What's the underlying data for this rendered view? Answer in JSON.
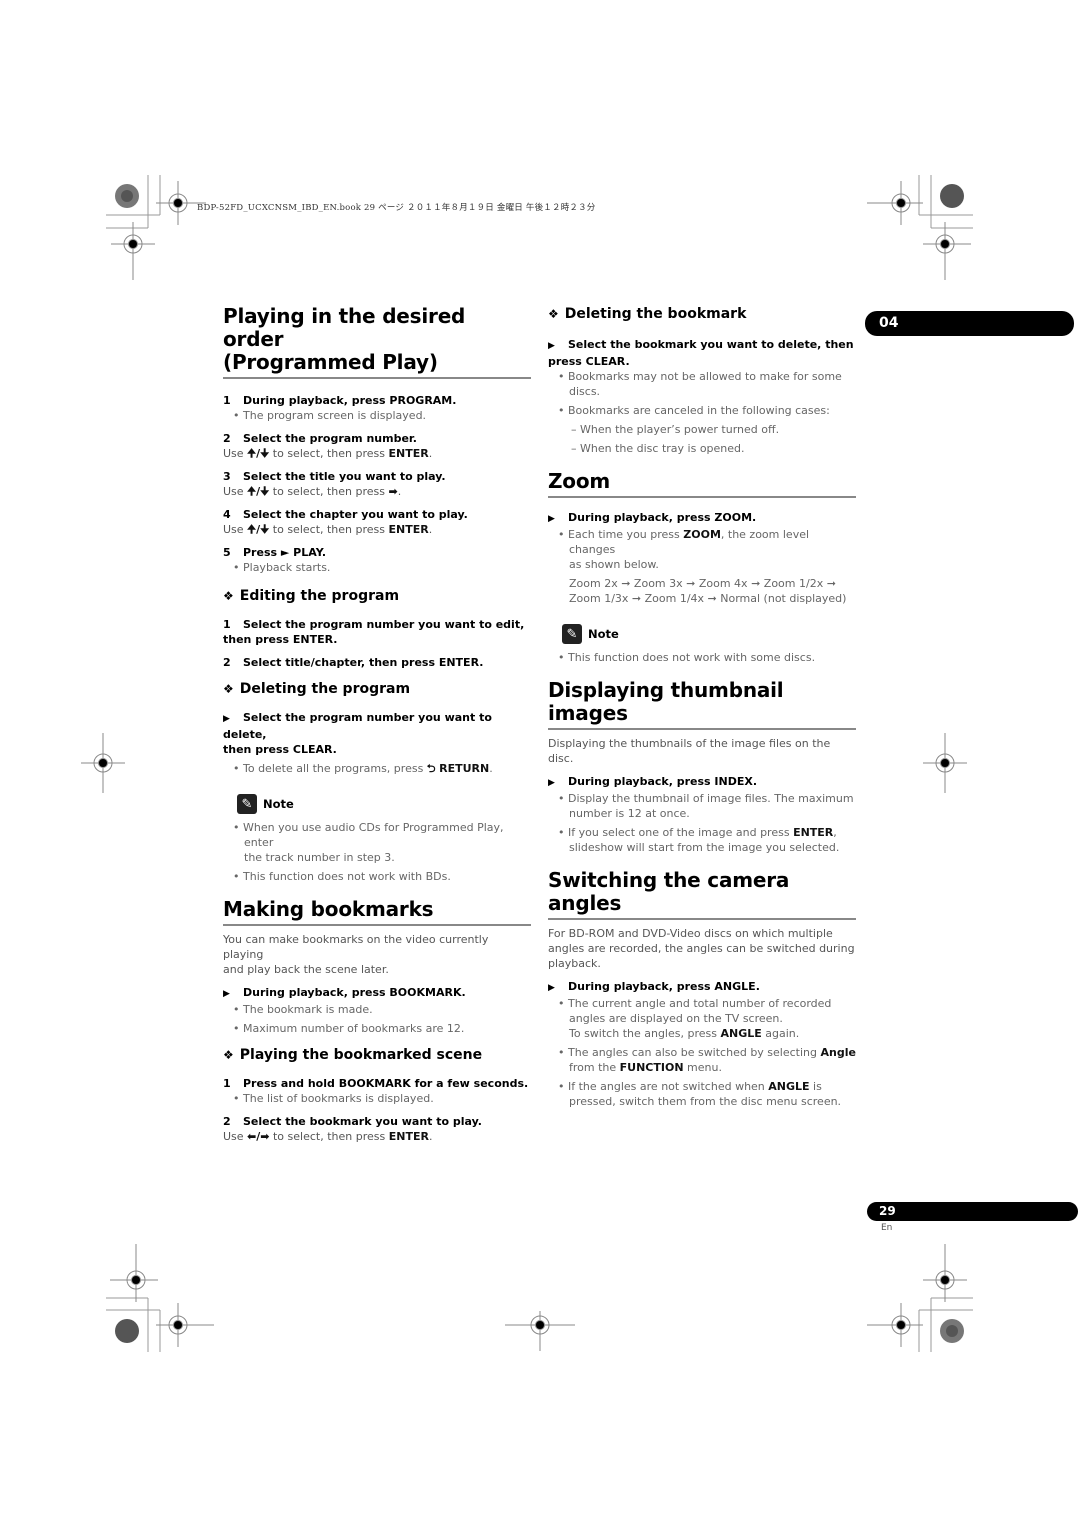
{
  "header": {
    "print_info": "BDP-52FD_UCXCNSM_IBD_EN.book  29 ページ  ２０１１年８月１９日  金曜日  午後１２時２３分"
  },
  "chapter_tab": {
    "number": "04"
  },
  "footer": {
    "page_number": "29",
    "language": "En"
  },
  "left": {
    "programmed": {
      "title_line1": "Playing in the desired order",
      "title_line2": "(Programmed Play)",
      "steps": [
        {
          "num": "1",
          "text": "During playback, press PROGRAM.",
          "bullet": "The program screen is displayed."
        },
        {
          "num": "2",
          "text": "Select the program number.",
          "use_pre": "Use ",
          "arrows": "🠉/🠋",
          "use_mid": " to select, then press ",
          "key": "ENTER",
          "end": "."
        },
        {
          "num": "3",
          "text": "Select the title you want to play.",
          "use_pre": "Use ",
          "arrows": "🠉/🠋",
          "use_mid": " to select, then press ",
          "key": "➡",
          "end": "."
        },
        {
          "num": "4",
          "text": "Select the chapter you want to play.",
          "use_pre": "Use ",
          "arrows": "🠉/🠋",
          "use_mid": " to select, then press ",
          "key": "ENTER",
          "end": "."
        },
        {
          "num": "5",
          "text": "Press ► PLAY.",
          "bullet": "Playback starts."
        }
      ]
    },
    "editing": {
      "title": "Editing the program",
      "steps": [
        {
          "num": "1",
          "line1": "Select the program number you want to edit,",
          "line2": "then press ENTER."
        },
        {
          "num": "2",
          "line1": "Select title/chapter, then press ENTER."
        }
      ]
    },
    "deleting_program": {
      "title": "Deleting the program",
      "step_line1": "Select the program number you want to delete,",
      "step_line2": "then press CLEAR.",
      "bullet_pre": "To delete all the programs, press ",
      "bullet_icon": "⮌",
      "bullet_key": "RETURN",
      "bullet_end": "."
    },
    "note1": {
      "label": "Note",
      "bullets": [
        {
          "line1": "When you use audio CDs for Programmed Play, enter",
          "line2": "the track number in step 3."
        },
        {
          "line1": "This function does not work with BDs."
        }
      ]
    },
    "bookmarks": {
      "title": "Making bookmarks",
      "intro_line1": "You can make bookmarks on the video currently playing",
      "intro_line2": "and play back the scene later.",
      "step": "During playback, press BOOKMARK.",
      "bullets": [
        "The bookmark is made.",
        "Maximum number of bookmarks are 12."
      ]
    },
    "playing_bookmarked": {
      "title": "Playing the bookmarked scene",
      "steps": [
        {
          "num": "1",
          "text": "Press and hold BOOKMARK for a few seconds.",
          "bullet": "The list of bookmarks is displayed."
        },
        {
          "num": "2",
          "text": "Select the bookmark you want to play.",
          "use_pre": "Use ",
          "arrows": "⬅/➡",
          "use_mid": " to select, then press ",
          "key": "ENTER",
          "end": "."
        }
      ]
    }
  },
  "right": {
    "deleting_bookmark": {
      "title": "Deleting the bookmark",
      "step_line1": "Select the bookmark you want to delete, then",
      "step_line2": "press CLEAR.",
      "bullet1_line1": "Bookmarks may not be allowed to make for some",
      "bullet1_line2": "discs.",
      "bullet2": "Bookmarks are canceled in the following cases:",
      "dashes": [
        "When the player’s power turned off.",
        "When the disc tray is opened."
      ]
    },
    "zoom": {
      "title": "Zoom",
      "step": "During playback, press ZOOM.",
      "bullet_pre": "Each time you press ",
      "bullet_key": "ZOOM",
      "bullet_post": ", the zoom level changes",
      "bullet_line2": "as shown below.",
      "sequence_line1": "Zoom 2x ➞ Zoom 3x ➞ Zoom 4x ➞ Zoom 1/2x ➞",
      "sequence_line2": "Zoom 1/3x ➞ Zoom 1/4x ➞ Normal (not displayed)"
    },
    "note2": {
      "label": "Note",
      "bullet": "This function does not work with some discs."
    },
    "thumbnails": {
      "title_line1": "Displaying thumbnail",
      "title_line2": "images",
      "intro": "Displaying the thumbnails of the image files on the disc.",
      "step": "During playback, press INDEX.",
      "bullet1_line1": "Display the thumbnail of image files. The maximum",
      "bullet1_line2": "number is 12 at once.",
      "bullet2_pre": "If you select one of the image and press ",
      "bullet2_key": "ENTER",
      "bullet2_post": ",",
      "bullet2_line2": "slideshow will start from the image you selected."
    },
    "angles": {
      "title": "Switching the camera angles",
      "intro_line1": "For BD-ROM and DVD-Video discs on which multiple",
      "intro_line2": "angles are recorded, the angles can be switched during",
      "intro_line3": "playback.",
      "step": "During playback, press ANGLE.",
      "b1_line1": "The current angle and total number of recorded",
      "b1_line2": "angles are displayed on the TV screen.",
      "b1_line3_pre": "To switch the angles, press ",
      "b1_line3_key": "ANGLE",
      "b1_line3_post": " again.",
      "b2_pre": "The angles can also be switched by selecting ",
      "b2_key": "Angle",
      "b2_line2_pre": "from the ",
      "b2_line2_key": "FUNCTION",
      "b2_line2_post": " menu.",
      "b3_pre": "If the angles are not switched when ",
      "b3_key": "ANGLE",
      "b3_post": " is",
      "b3_line2": "pressed, switch them from the disc menu screen."
    }
  }
}
